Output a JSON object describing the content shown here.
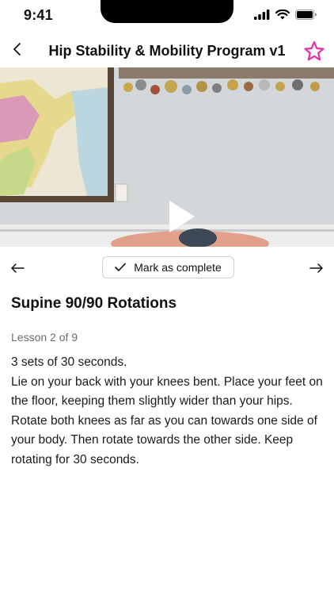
{
  "status_bar": {
    "time": "9:41"
  },
  "nav": {
    "title": "Hip Stability & Mobility Program v1",
    "accent_color": "#e22fa6"
  },
  "video": {
    "state": "paused"
  },
  "lesson_nav": {
    "mark_complete_label": "Mark as complete"
  },
  "lesson": {
    "title": "Supine 90/90 Rotations",
    "meta": "Lesson 2 of 9",
    "sets": "3 sets of 30 seconds.",
    "instructions": "Lie on your back with your knees bent. Place your feet on the floor, keeping them slightly wider than your hips. Rotate both knees as far as you can towards one side of your body. Then rotate towards the other side. Keep rotating for 30 seconds."
  }
}
